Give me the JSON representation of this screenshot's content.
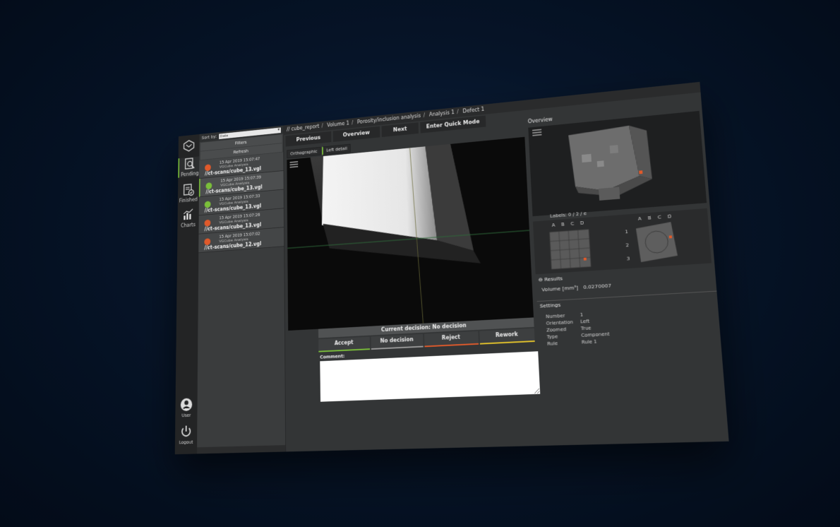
{
  "rail": {
    "items": [
      {
        "label": "Pending",
        "icon": "pending-inspection-icon",
        "active": true
      },
      {
        "label": "Finished",
        "icon": "finished-report-icon",
        "active": false
      },
      {
        "label": "Charts",
        "icon": "bar-chart-icon",
        "active": false
      }
    ],
    "user_label": "User",
    "logout_label": "Logout"
  },
  "files": {
    "sort_label": "Sort by:",
    "sort_value": "Date",
    "filters_label": "Filters",
    "refresh_label": "Refresh",
    "items": [
      {
        "date": "15 Apr 2019 15:07:47",
        "app": "VGCube Analysis",
        "path": "//ct-scans/cube_13.vgl",
        "status": "#e05a2b"
      },
      {
        "date": "15 Apr 2019 15:07:39",
        "app": "VGCube Analysis",
        "path": "//ct-scans/cube_13.vgl",
        "status": "#7bbf3a"
      },
      {
        "date": "15 Apr 2019 15:07:33",
        "app": "VGCube Analysis",
        "path": "//ct-scans/cube_13.vgl",
        "status": "#7bbf3a"
      },
      {
        "date": "15 Apr 2019 15:07:26",
        "app": "VGCube Analysis",
        "path": "//ct-scans/cube_13.vgl",
        "status": "#e05a2b"
      },
      {
        "date": "15 Apr 2019 15:07:02",
        "app": "VGCube Analysis",
        "path": "//ct-scans/cube_12.vgl",
        "status": "#e05a2b"
      }
    ]
  },
  "breadcrumb": {
    "prefix": "//",
    "parts": [
      "cube_report",
      "Volume 1",
      "Porosity/inclusion analysis",
      "Analysis 1",
      "Defect 1"
    ]
  },
  "nav": {
    "previous": "Previous",
    "overview": "Overview",
    "next": "Next",
    "quick_mode": "Enter Quick Mode"
  },
  "view_tabs": [
    "Orthographic",
    "Left detail"
  ],
  "decision": {
    "current": "Current decision: No decision",
    "buttons": [
      {
        "label": "Accept",
        "color": "#7bbf3a"
      },
      {
        "label": "No decision",
        "color": "#9a9a9a"
      },
      {
        "label": "Reject",
        "color": "#e05a2b"
      },
      {
        "label": "Rework",
        "color": "#e0c02b"
      }
    ],
    "comment_label": "Comment:"
  },
  "overview": {
    "title": "Overview",
    "labels": "Labels: 0 / 2 / e",
    "grid_cols": [
      "A",
      "B",
      "C",
      "D"
    ],
    "grid_rows": [
      "1",
      "2",
      "3"
    ],
    "results_label": "Results",
    "volume_label": "Volume [mm³]",
    "volume_value": "0.0270007",
    "settings_label": "Settings",
    "settings": [
      {
        "k": "Number",
        "v": "1"
      },
      {
        "k": "Orientation",
        "v": "Left"
      },
      {
        "k": "Zoomed",
        "v": "True"
      },
      {
        "k": "Type",
        "v": "Component"
      },
      {
        "k": "Rule",
        "v": "Rule 1"
      }
    ]
  },
  "colors": {
    "accent": "#7bbf3a",
    "reject": "#e05a2b",
    "rework": "#e0c02b"
  }
}
